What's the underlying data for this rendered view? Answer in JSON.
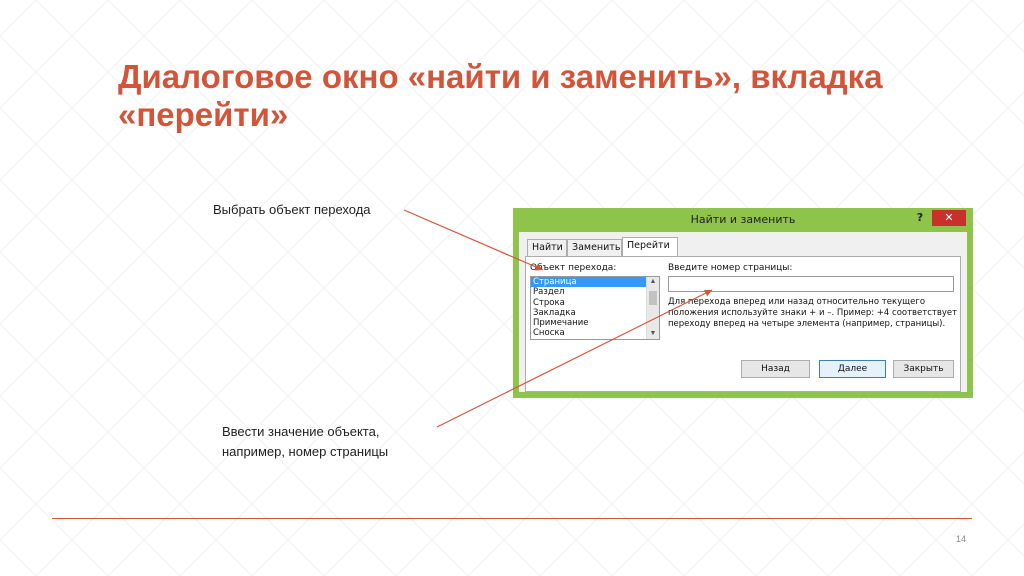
{
  "slide": {
    "title": "Диалоговое окно «найти и заменить», вкладка «перейти»",
    "page_number": "14",
    "accent_color": "#d2553a"
  },
  "callouts": {
    "select_object": "Выбрать объект перехода",
    "enter_value_line1": "Ввести значение объекта,",
    "enter_value_line2": "например, номер страницы"
  },
  "dialog": {
    "title": "Найти и заменить",
    "help_label": "?",
    "close_label": "✕",
    "frame_color": "#8ec449",
    "tabs": [
      {
        "label": "Найти",
        "active": false
      },
      {
        "label": "Заменить",
        "active": false
      },
      {
        "label": "Перейти",
        "active": true
      }
    ],
    "object_label": "Объект перехода:",
    "objects": [
      {
        "label": "Страница",
        "selected": true
      },
      {
        "label": "Раздел",
        "selected": false
      },
      {
        "label": "Строка",
        "selected": false
      },
      {
        "label": "Закладка",
        "selected": false
      },
      {
        "label": "Примечание",
        "selected": false
      },
      {
        "label": "Сноска",
        "selected": false
      }
    ],
    "input_label": "Введите номер страницы:",
    "input_value": "",
    "help_text": "Для перехода вперед или назад относительно текущего положения используйте знаки + и –. Пример: +4 соответствует переходу вперед на четыре элемента (например, страницы).",
    "buttons": {
      "back": "Назад",
      "next": "Далее",
      "close": "Закрыть"
    }
  }
}
